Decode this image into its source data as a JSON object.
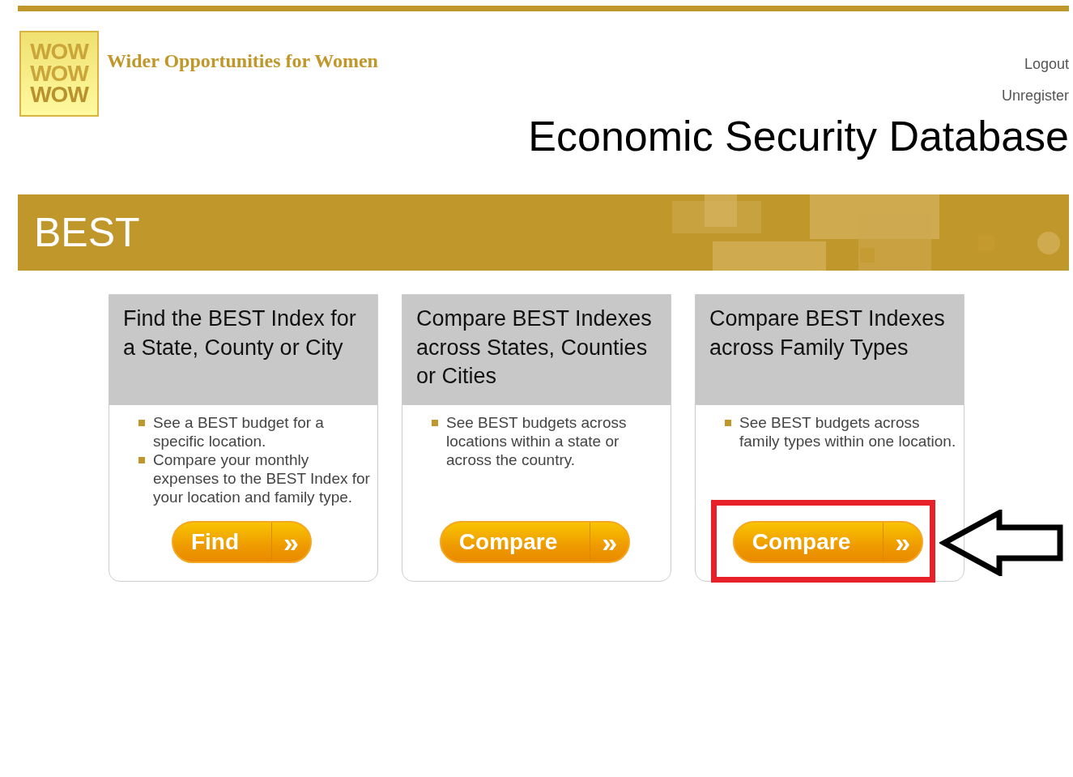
{
  "header": {
    "logo_lines": [
      "WOW",
      "WOW",
      "WOW"
    ],
    "org_name": "Wider Opportunities for Women",
    "links": [
      "Logout",
      "Unregister"
    ],
    "title": "Economic Security Database"
  },
  "banner": {
    "title": "BEST"
  },
  "cards": [
    {
      "title": "Find the BEST Index for a State, County or City",
      "bullets": [
        "See a BEST budget for a specific location.",
        "Compare your monthly expenses to the BEST Index for your location and family type."
      ],
      "button": {
        "label": "Find",
        "arrow": "»"
      },
      "highlighted": false
    },
    {
      "title": "Compare BEST Indexes across States, Counties or Cities",
      "bullets": [
        "See BEST budgets across locations within a state or across the country."
      ],
      "button": {
        "label": "Compare",
        "arrow": "»"
      },
      "highlighted": false
    },
    {
      "title": "Compare BEST Indexes across Family Types",
      "bullets": [
        "See BEST budgets across family types within one location."
      ],
      "button": {
        "label": "Compare",
        "arrow": "»"
      },
      "highlighted": true
    }
  ]
}
